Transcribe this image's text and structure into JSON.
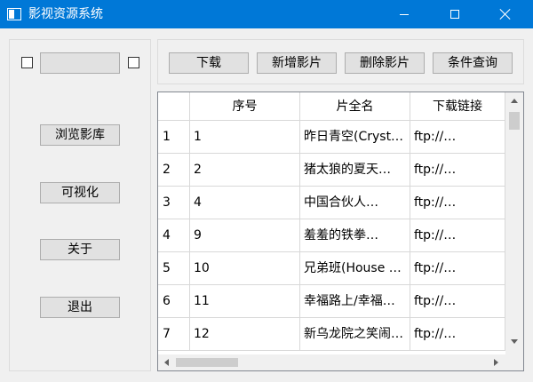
{
  "window": {
    "title": "影视资源系统"
  },
  "sidebar": {
    "buttons": [
      "浏览影库",
      "可视化",
      "关于",
      "退出"
    ]
  },
  "toolbar": {
    "buttons": [
      "下载",
      "新增影片",
      "删除影片",
      "条件查询"
    ]
  },
  "table": {
    "columns": [
      "序号",
      "片全名",
      "下载链接"
    ],
    "rows": [
      {
        "header": "1",
        "cells": [
          "1",
          "昨日青空(Cryst…",
          "ftp://…"
        ]
      },
      {
        "header": "2",
        "cells": [
          "2",
          "猪太狼的夏天…",
          "ftp://…"
        ]
      },
      {
        "header": "3",
        "cells": [
          "4",
          "中国合伙人…",
          "ftp://…"
        ]
      },
      {
        "header": "4",
        "cells": [
          "9",
          "羞羞的铁拳…",
          "ftp://…"
        ]
      },
      {
        "header": "5",
        "cells": [
          "10",
          "兄弟班(House …",
          "ftp://…"
        ]
      },
      {
        "header": "6",
        "cells": [
          "11",
          "幸福路上/幸福…",
          "ftp://…"
        ]
      },
      {
        "header": "7",
        "cells": [
          "12",
          "新乌龙院之笑闹…",
          "ftp://…"
        ]
      }
    ]
  },
  "colors": {
    "titlebar": "#0078d7",
    "button_bg": "#e1e1e1"
  }
}
